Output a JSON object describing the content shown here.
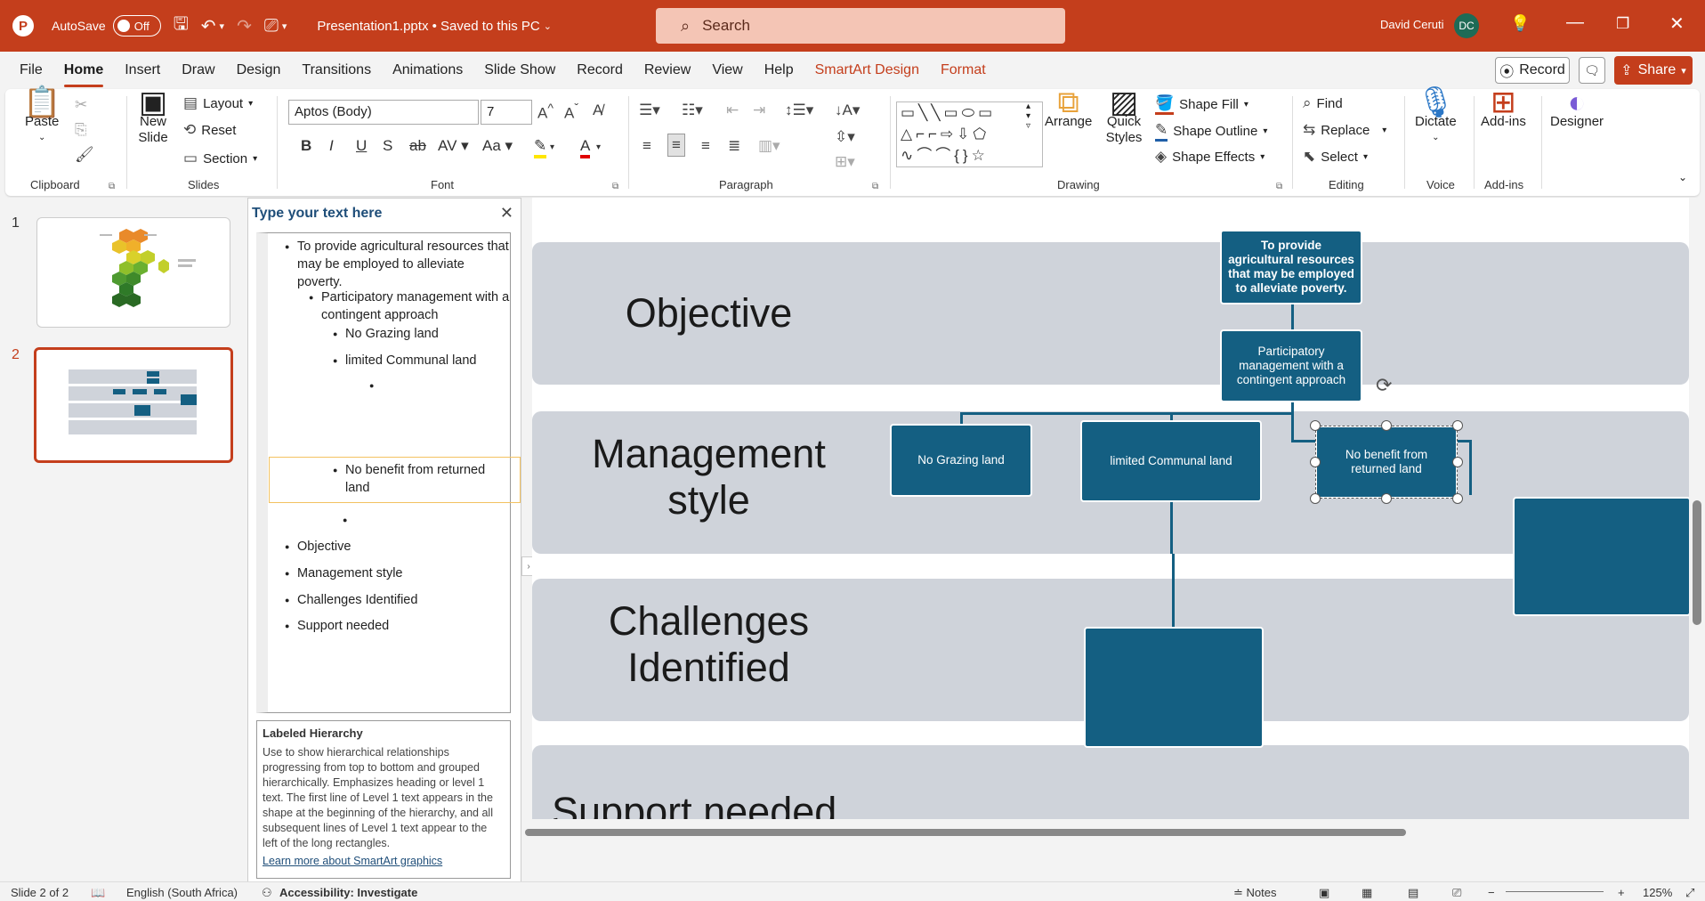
{
  "titlebar": {
    "logo": "P",
    "autosave_label": "AutoSave",
    "autosave_state": "Off",
    "filename": "Presentation1.pptx • Saved to this PC",
    "search_placeholder": "Search",
    "user_name": "David Ceruti",
    "user_initials": "DC"
  },
  "tabs": [
    "File",
    "Home",
    "Insert",
    "Draw",
    "Design",
    "Transitions",
    "Animations",
    "Slide Show",
    "Record",
    "Review",
    "View",
    "Help",
    "SmartArt Design",
    "Format"
  ],
  "tab_actions": {
    "record": "Record",
    "share": "Share"
  },
  "ribbon": {
    "clipboard": {
      "paste": "Paste",
      "label": "Clipboard"
    },
    "slides": {
      "new_slide": "New Slide",
      "layout": "Layout",
      "reset": "Reset",
      "section": "Section",
      "label": "Slides"
    },
    "font": {
      "family": "Aptos (Body)",
      "size": "7",
      "label": "Font"
    },
    "paragraph": {
      "label": "Paragraph"
    },
    "drawing": {
      "arrange": "Arrange",
      "quick_styles": "Quick Styles",
      "shape_fill": "Shape Fill",
      "shape_outline": "Shape Outline",
      "shape_effects": "Shape Effects",
      "label": "Drawing"
    },
    "editing": {
      "find": "Find",
      "replace": "Replace",
      "select": "Select",
      "label": "Editing"
    },
    "voice": {
      "dictate": "Dictate",
      "label": "Voice"
    },
    "addins": {
      "addins": "Add-ins",
      "label": "Add-ins"
    },
    "designer": {
      "designer": "Designer"
    }
  },
  "thumbnails": {
    "slide1": "1",
    "slide2": "2"
  },
  "text_pane": {
    "title": "Type your text here",
    "items": [
      "To provide agricultural resources that may be employed to alleviate poverty.",
      "Participatory management with a contingent approach",
      "No Grazing land",
      "limited Communal land",
      "No benefit from returned land",
      "Objective",
      "Management style",
      "Challenges Identified",
      "Support needed"
    ],
    "info_title": "Labeled Hierarchy",
    "info_body": "Use to show hierarchical relationships progressing from top to bottom and grouped hierarchically. Emphasizes heading or level 1 text. The first line of Level 1 text appears in the shape at the beginning of the hierarchy, and all subsequent lines of Level 1 text appear to the left of the long rectangles.",
    "info_link": "Learn more about SmartArt graphics"
  },
  "slide": {
    "bands": [
      "Objective",
      "Management style",
      "Challenges Identified",
      "Support needed"
    ],
    "nodes": {
      "top": "To provide agricultural resources that may be employed to alleviate poverty.",
      "mgmt": "Participatory management with a contingent approach",
      "n1": "No Grazing land",
      "n2": "limited Communal land",
      "n3": "No benefit from returned land"
    },
    "colors": {
      "node": "#145f82",
      "band": "#cfd3da",
      "accent": "#c43e1c"
    }
  },
  "status": {
    "slide": "Slide 2 of 2",
    "language": "English (South Africa)",
    "accessibility": "Accessibility: Investigate",
    "notes": "Notes",
    "zoom": "125%"
  }
}
